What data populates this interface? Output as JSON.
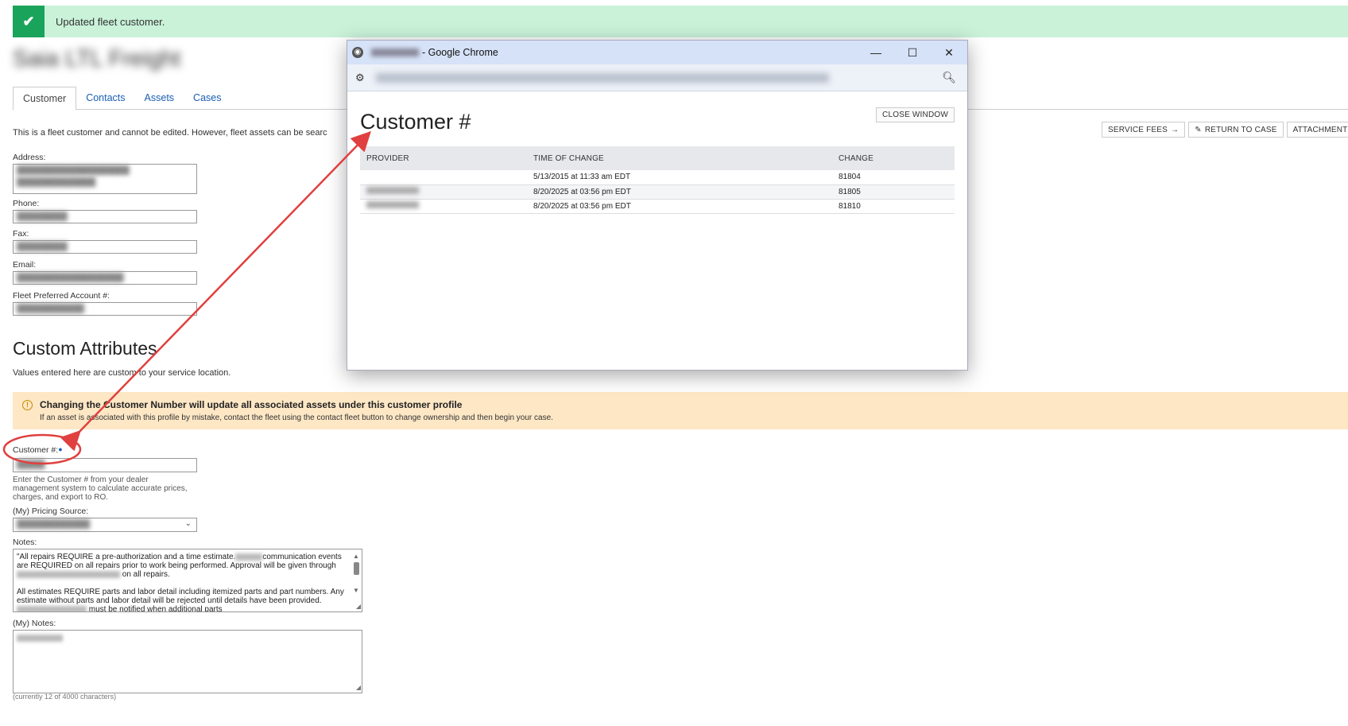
{
  "banner": {
    "message": "Updated fleet customer.",
    "icon": "check-icon",
    "color": "#1aa35a"
  },
  "customer": {
    "name": "Saia LTL Freight"
  },
  "tabs": [
    {
      "label": "Customer",
      "active": true
    },
    {
      "label": "Contacts",
      "active": false
    },
    {
      "label": "Assets",
      "active": false
    },
    {
      "label": "Cases",
      "active": false
    }
  ],
  "info_text": "This is a fleet customer and cannot be edited. However, fleet assets can be searc",
  "actions": {
    "service_fees": "SERVICE FEES",
    "return_to_case": "RETURN TO CASE",
    "attachments": "ATTACHMENTS"
  },
  "fields": {
    "address_label": "Address:",
    "phone_label": "Phone:",
    "fax_label": "Fax:",
    "email_label": "Email:",
    "fleet_account_label": "Fleet Preferred Account #:"
  },
  "custom_attributes": {
    "heading": "Custom Attributes",
    "subtext": "Values entered here are custom to your service location."
  },
  "warning": {
    "title": "Changing the Customer Number will update all associated assets under this customer profile",
    "body": "If an asset is associated with this profile by mistake, contact the fleet using the contact fleet button to change ownership and then begin your case.",
    "color": "#fde7c5"
  },
  "customer_number": {
    "label": "Customer #:",
    "help": "Enter the Customer # from your dealer management system to calculate accurate prices, charges, and export to RO."
  },
  "pricing_source": {
    "label": "(My) Pricing Source:"
  },
  "notes": {
    "label": "Notes:",
    "line1": "\"All repairs REQUIRE a pre-authorization and a time estimate.",
    "line1b": "communication events are REQUIRED on all repairs prior to work being performed.  Approval will be given through",
    "line1c": "on all repairs.",
    "line2": "All estimates REQUIRE parts and labor detail including itemized parts and part numbers. Any estimate without parts and labor detail will be rejected until details have been provided.",
    "line2b": "must be notified when additional parts"
  },
  "my_notes": {
    "label": "(My) Notes:",
    "count_text": "(currently 12 of 4000 characters)"
  },
  "popup": {
    "title_suffix": "- Google Chrome",
    "heading": "Customer #",
    "close_label": "CLOSE WINDOW",
    "columns": [
      "PROVIDER",
      "TIME OF CHANGE",
      "CHANGE"
    ],
    "rows": [
      {
        "time": "5/13/2015 at 11:33 am EDT",
        "change": "81804"
      },
      {
        "time": "8/20/2025 at 03:56 pm EDT",
        "change": "81805"
      },
      {
        "time": "8/20/2025 at 03:56 pm EDT",
        "change": "81810"
      }
    ]
  },
  "annotation_color": "#e0403f"
}
